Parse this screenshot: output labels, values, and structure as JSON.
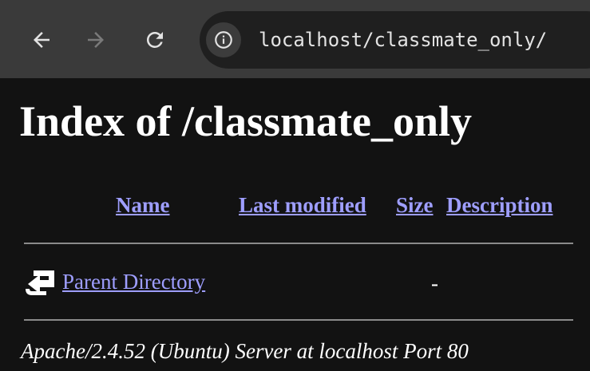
{
  "browser": {
    "url": "localhost/classmate_only/",
    "icons": {
      "back": "arrow-left-icon",
      "forward": "arrow-right-icon",
      "reload": "reload-icon",
      "site_info": "info-icon"
    }
  },
  "page": {
    "title": "Index of /classmate_only",
    "columns": {
      "name": "Name",
      "last_modified": "Last modified",
      "size": "Size",
      "description": "Description"
    },
    "rows": [
      {
        "icon": "back-folder-icon",
        "name": "Parent Directory",
        "last_modified": "",
        "size": "-",
        "description": ""
      }
    ],
    "footer": "Apache/2.4.52 (Ubuntu) Server at localhost Port 80"
  },
  "colors": {
    "link": "#9e9eff",
    "background": "#121212",
    "toolbar": "#3a3a3a",
    "omnibox": "#1f1f1f"
  }
}
